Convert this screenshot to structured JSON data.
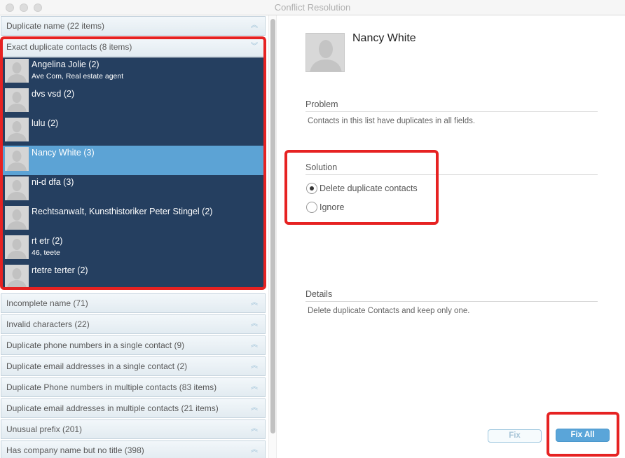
{
  "window": {
    "title": "Conflict Resolution"
  },
  "groups_top": [
    {
      "label": "Duplicate name (22 items)",
      "state": "collapsed",
      "chevron": "double-chevron-up-icon"
    },
    {
      "label": "Exact duplicate contacts (8 items)",
      "state": "expanded",
      "chevron": "double-chevron-down-icon"
    }
  ],
  "contacts": [
    {
      "name": "Angelina Jolie (2)",
      "subtitle": "Ave Com, Real estate agent",
      "selected": false
    },
    {
      "name": "dvs vsd (2)",
      "subtitle": "",
      "selected": false
    },
    {
      "name": "lulu (2)",
      "subtitle": "",
      "selected": false
    },
    {
      "name": "Nancy White (3)",
      "subtitle": "",
      "selected": true
    },
    {
      "name": "ni-d dfa (3)",
      "subtitle": "",
      "selected": false
    },
    {
      "name": "Rechtsanwalt, Kunsthistoriker Peter Stingel (2)",
      "subtitle": "",
      "selected": false
    },
    {
      "name": "rt etr (2)",
      "subtitle": "46, teete",
      "selected": false
    },
    {
      "name": "rtetre terter (2)",
      "subtitle": "",
      "selected": false
    }
  ],
  "groups_bottom": [
    {
      "label": "Incomplete name (71)"
    },
    {
      "label": "Invalid characters (22)"
    },
    {
      "label": "Duplicate phone numbers in a single contact (9)"
    },
    {
      "label": "Duplicate email addresses in a single contact (2)"
    },
    {
      "label": "Duplicate Phone numbers in multiple contacts (83 items)"
    },
    {
      "label": "Duplicate email addresses in multiple contacts (21 items)"
    },
    {
      "label": "Unusual prefix (201)"
    },
    {
      "label": "Has company name but no title (398)"
    }
  ],
  "detail": {
    "contact_name": "Nancy White",
    "problem": {
      "label": "Problem",
      "text": "Contacts in this list have duplicates in all fields."
    },
    "solution": {
      "label": "Solution",
      "options": [
        {
          "label": "Delete duplicate contacts",
          "checked": true
        },
        {
          "label": "Ignore",
          "checked": false
        }
      ]
    },
    "details": {
      "label": "Details",
      "text": "Delete duplicate Contacts and keep only one."
    }
  },
  "buttons": {
    "fix": "Fix",
    "fix_all": "Fix All"
  },
  "colors": {
    "list_bg": "#253f60",
    "selected_row": "#5ca3d5",
    "highlight_box": "#e62222",
    "primary_button": "#5aa5d9"
  }
}
